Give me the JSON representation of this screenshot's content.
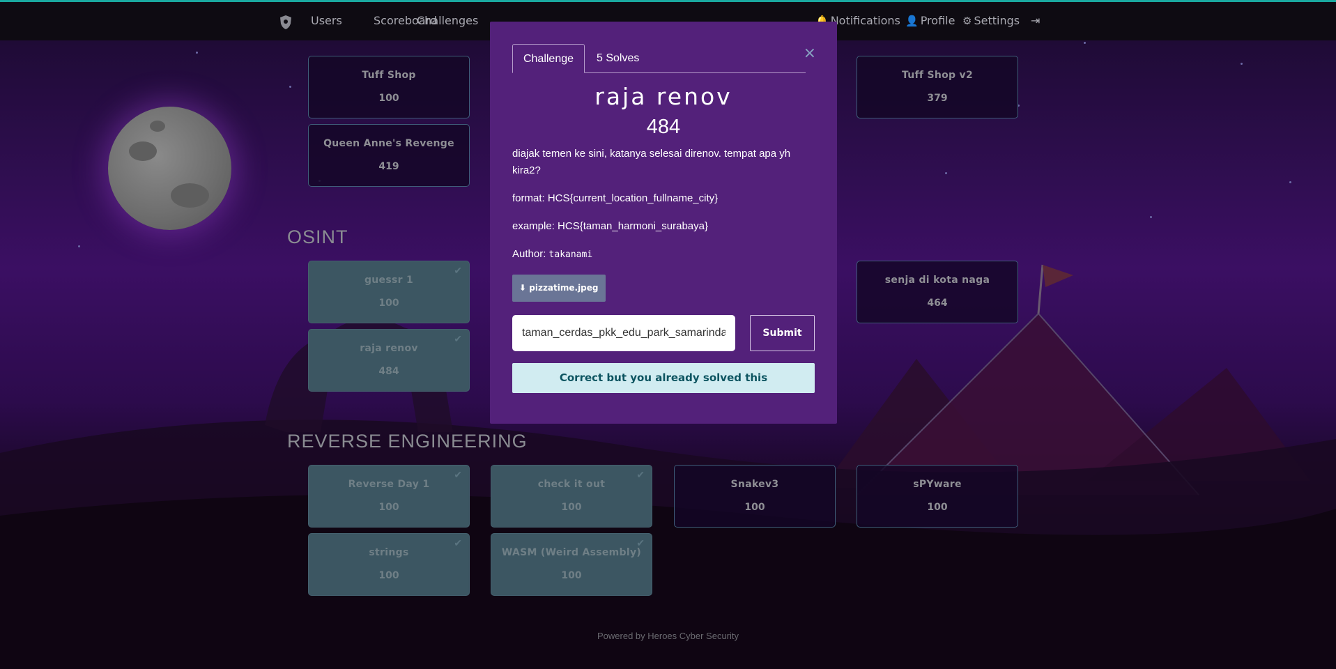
{
  "nav": {
    "left": [
      "Users",
      "Scoreboard",
      "Challenges"
    ],
    "notifications": "Notifications",
    "profile": "Profile",
    "settings": "Settings",
    "logo_icon": "shield-icon",
    "logout_icon": "sign-out-icon"
  },
  "sections": {
    "osint": "OSINT",
    "reverse": "REVERSE ENGINEERING"
  },
  "cards": {
    "tuff_shop": {
      "name": "Tuff Shop",
      "value": "100"
    },
    "tuff_shop_v2": {
      "name": "Tuff Shop v2",
      "value": "379"
    },
    "queen_anne": {
      "name": "Queen Anne's Revenge",
      "value": "419"
    },
    "guessr1": {
      "name": "guessr 1",
      "value": "100"
    },
    "senja": {
      "name": "senja di kota naga",
      "value": "464"
    },
    "raja_renov": {
      "name": "raja renov",
      "value": "484"
    },
    "reverse_day1": {
      "name": "Reverse Day 1",
      "value": "100"
    },
    "check_it_out": {
      "name": "check it out",
      "value": "100"
    },
    "snakev3": {
      "name": "Snakev3",
      "value": "100"
    },
    "spyware": {
      "name": "sPYware",
      "value": "100"
    },
    "strings": {
      "name": "strings",
      "value": "100"
    },
    "wasm": {
      "name": "WASM (Weird Assembly)",
      "value": "100"
    }
  },
  "modal": {
    "tab_challenge": "Challenge",
    "tab_solves": "5 Solves",
    "close": "×",
    "title": "raja renov",
    "value": "484",
    "description": "diajak temen ke sini, katanya selesai direnov. tempat apa yh kira2?",
    "format": "format: HCS{current_location_fullname_city}",
    "example": "example: HCS{taman_harmoni_surabaya}",
    "author_label": "Author:",
    "author": "takanami",
    "file": "pizzatime.jpeg",
    "flag_value": "taman_cerdas_pkk_edu_park_samarinda",
    "submit": "Submit",
    "result": "Correct but you already solved this"
  },
  "footer": "Powered by Heroes Cyber Security",
  "colors": {
    "modal_bg": "#53217a",
    "solved_card": "#3c5662",
    "alert_bg": "#d1ecf1",
    "alert_text": "#0c5460",
    "accent_top": "#1aa9a0"
  }
}
